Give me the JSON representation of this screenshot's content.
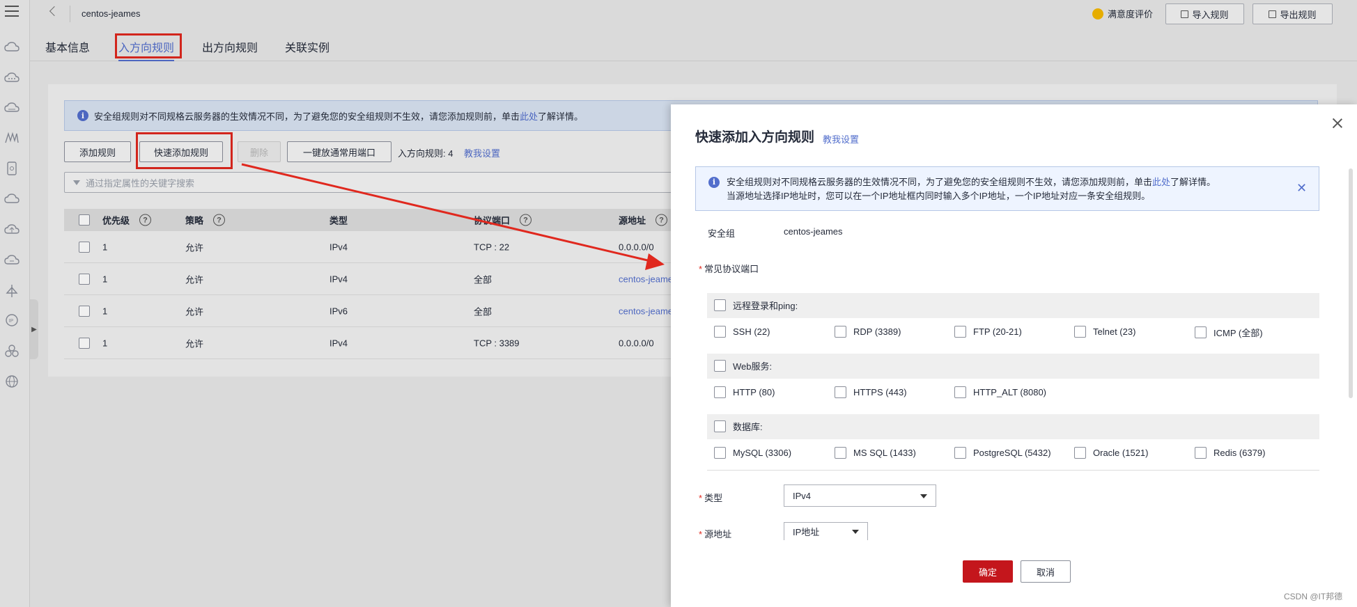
{
  "header": {
    "title": "centos-jeames",
    "satisfaction": "满意度评价",
    "import_label": "导入规则",
    "export_label": "导出规则"
  },
  "tabs": [
    "基本信息",
    "入方向规则",
    "出方向规则",
    "关联实例"
  ],
  "info": {
    "text": "安全组规则对不同规格云服务器的生效情况不同，为了避免您的安全组规则不生效，请您添加规则前，单击",
    "link": "此处",
    "tail": "了解详情。"
  },
  "toolbar": {
    "add": "添加规则",
    "quick_add": "快速添加规则",
    "delete": "删除",
    "open_common": "一键放通常用端口",
    "count": "入方向规则: 4",
    "teach": "教我设置"
  },
  "search": {
    "placeholder": "通过指定属性的关键字搜索"
  },
  "table": {
    "headers": [
      "优先级",
      "策略",
      "类型",
      "协议端口",
      "源地址"
    ],
    "rows": [
      [
        "1",
        "允许",
        "IPv4",
        "TCP : 22",
        "0.0.0.0/0"
      ],
      [
        "1",
        "允许",
        "IPv4",
        "全部",
        "centos-jeame"
      ],
      [
        "1",
        "允许",
        "IPv6",
        "全部",
        "centos-jeame"
      ],
      [
        "1",
        "允许",
        "IPv4",
        "TCP : 3389",
        "0.0.0.0/0"
      ]
    ]
  },
  "drawer": {
    "title": "快速添加入方向规则",
    "teach": "教我设置",
    "info_line1": "安全组规则对不同规格云服务器的生效情况不同，为了避免您的安全组规则不生效，请您添加规则前，单击",
    "info_link": "此处",
    "info_tail": "了解详情。",
    "info_line2": "当源地址选择IP地址时，您可以在一个IP地址框内同时输入多个IP地址，一个IP地址对应一条安全组规则。",
    "sg_label": "安全组",
    "sg_value": "centos-jeames",
    "ports_label": "常见协议端口",
    "groups": [
      {
        "name": "远程登录和ping:",
        "items": [
          "SSH (22)",
          "RDP (3389)",
          "FTP (20-21)",
          "Telnet (23)",
          "ICMP (全部)"
        ]
      },
      {
        "name": "Web服务:",
        "items": [
          "HTTP (80)",
          "HTTPS (443)",
          "HTTP_ALT (8080)"
        ]
      },
      {
        "name": "数据库:",
        "items": [
          "MySQL (3306)",
          "MS SQL (1433)",
          "PostgreSQL (5432)",
          "Oracle (1521)",
          "Redis (6379)"
        ]
      }
    ],
    "type_label": "类型",
    "type_value": "IPv4",
    "source_label": "源地址",
    "source_value": "IP地址",
    "confirm": "确定",
    "cancel": "取消"
  },
  "watermark": "CSDN @IT邦德",
  "colors": {
    "accent": "#526ecc",
    "highlight": "#e0281e",
    "confirm": "#c4161c"
  }
}
